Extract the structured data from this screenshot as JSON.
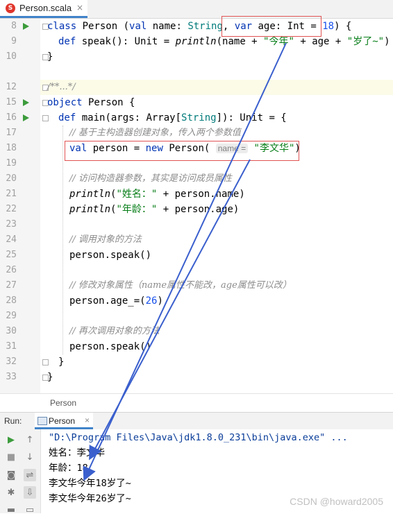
{
  "tab": {
    "icon": "scala-file-icon",
    "name": "Person.scala",
    "close": "×"
  },
  "lines": [
    {
      "n": "8"
    },
    {
      "n": "9"
    },
    {
      "n": "10"
    },
    {
      "n": "12"
    },
    {
      "n": "15"
    },
    {
      "n": "16"
    },
    {
      "n": "17"
    },
    {
      "n": "18"
    },
    {
      "n": "19"
    },
    {
      "n": "20"
    },
    {
      "n": "21"
    },
    {
      "n": "22"
    },
    {
      "n": "23"
    },
    {
      "n": "24"
    },
    {
      "n": "25"
    },
    {
      "n": "26"
    },
    {
      "n": "27"
    },
    {
      "n": "28"
    },
    {
      "n": "29"
    },
    {
      "n": "30"
    },
    {
      "n": "31"
    },
    {
      "n": "32"
    },
    {
      "n": "33"
    }
  ],
  "code": {
    "l8": {
      "kw1": "class",
      "a": " Person (",
      "kw2": "val",
      "b": " name: ",
      "t1": "String",
      "c": ", ",
      "kw3": "var",
      "d": " age: Int = ",
      "num": "18",
      "e": ") {"
    },
    "l9": {
      "kw": "def",
      "a": " speak(): Unit = ",
      "fn": "println",
      "b": "(name + ",
      "s1": "\"今年\"",
      "c": " + age + ",
      "s2": "\"岁了~\"",
      "d": ")"
    },
    "l10": "}",
    "l12": "/**...*/",
    "l15": {
      "kw": "object",
      "a": " Person {"
    },
    "l16": {
      "kw": "def",
      "a": " main(args: Array[",
      "t": "String",
      "b": "]): Unit = {"
    },
    "l17": "// 基于主构造器创建对象，传入两个参数值",
    "l18": {
      "kw1": "val",
      "a": " person = ",
      "kw2": "new",
      "b": " Person( ",
      "hint": "name =",
      "c": " ",
      "s": "\"李文华\"",
      "d": ")"
    },
    "l20": "// 访问构造器参数，其实是访问成员属性",
    "l21": {
      "fn": "println",
      "a": "(",
      "s": "\"姓名：\"",
      "b": " + person.name)"
    },
    "l22": {
      "fn": "println",
      "a": "(",
      "s": "\"年龄：\"",
      "b": " + person.age)"
    },
    "l24": "// 调用对象的方法",
    "l25": "person.speak()",
    "l27": "// 修改对象属性（name属性不能改，age属性可以改）",
    "l28": {
      "a": "person.age_=(",
      "num": "26",
      "b": ")"
    },
    "l30": "// 再次调用对象的方法",
    "l31": "person.speak()",
    "l32": "}",
    "l33": "}"
  },
  "breadcrumb": "Person",
  "run": {
    "label": "Run:",
    "tab": "Person",
    "close": "×"
  },
  "console": [
    "\"D:\\Program Files\\Java\\jdk1.8.0_231\\bin\\java.exe\" ...",
    "姓名：李文华",
    "年龄：18",
    "李文华今年18岁了~",
    "李文华今年26岁了~"
  ],
  "watermark": "CSDN @howard2005",
  "colors": {
    "keyword": "#0033b3",
    "string": "#067d17",
    "number": "#1750eb",
    "comment": "#8c8c8c",
    "annotation_box": "#e05252",
    "arrow": "#3a5fcd",
    "tab_accent": "#4083c9"
  }
}
